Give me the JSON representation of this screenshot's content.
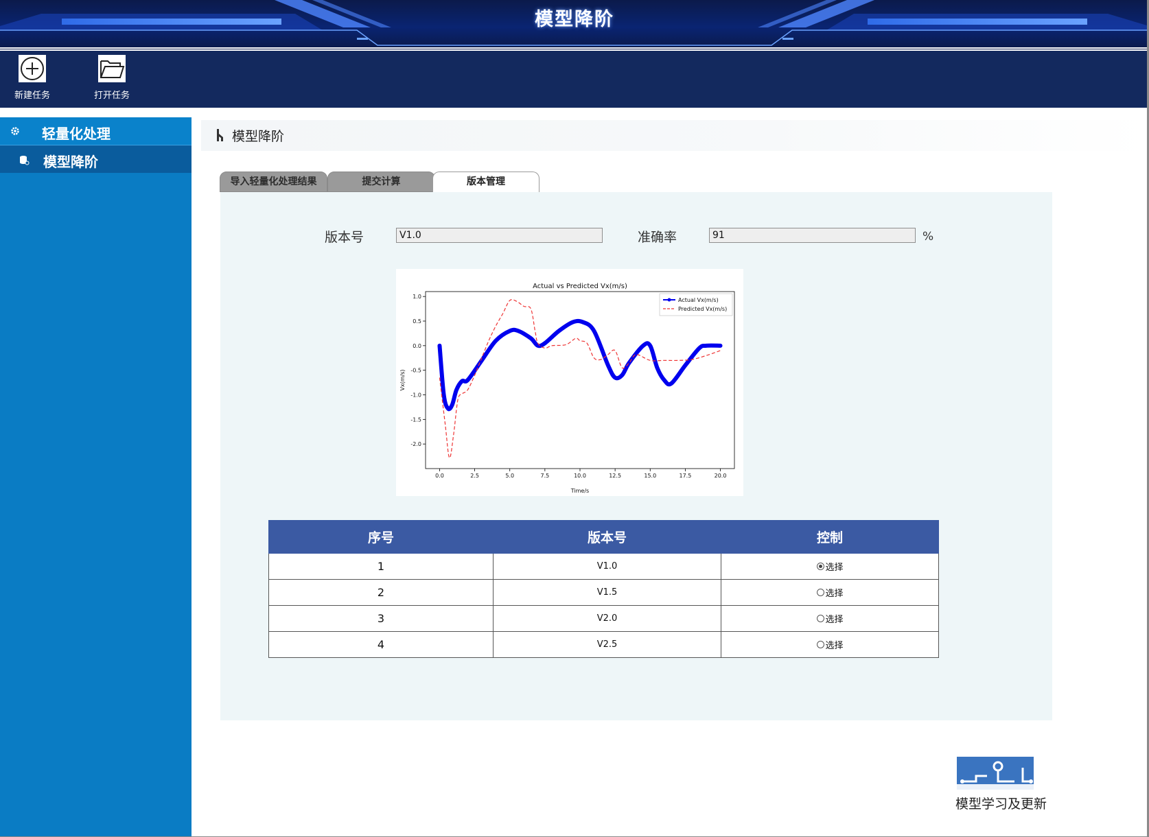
{
  "app": {
    "title": "模型降阶"
  },
  "toolbar": {
    "new_task": {
      "label": "新建任务",
      "icon": "plus-circle-icon"
    },
    "open_task": {
      "label": "打开任务",
      "icon": "folder-open-icon"
    }
  },
  "sidebar": {
    "group": {
      "label": "轻量化处理",
      "icon": "gear-icon"
    },
    "items": [
      {
        "label": "模型降阶",
        "icon": "database-icon",
        "active": true
      }
    ]
  },
  "content": {
    "title": "模型降阶",
    "tabs": [
      {
        "label": "导入轻量化处理结果",
        "active": false
      },
      {
        "label": "提交计算",
        "active": false
      },
      {
        "label": "版本管理",
        "active": true
      }
    ],
    "form": {
      "version_label": "版本号",
      "version_value": "V1.0",
      "accuracy_label": "准确率",
      "accuracy_value": "91",
      "accuracy_unit": "%"
    },
    "table": {
      "headers": [
        "序号",
        "版本号",
        "控制"
      ],
      "rows": [
        {
          "index": "1",
          "version": "V1.0",
          "control": "选择",
          "selected": true
        },
        {
          "index": "2",
          "version": "V1.5",
          "control": "选择",
          "selected": false
        },
        {
          "index": "3",
          "version": "V2.0",
          "control": "选择",
          "selected": false
        },
        {
          "index": "4",
          "version": "V2.5",
          "control": "选择",
          "selected": false
        }
      ]
    }
  },
  "logo": {
    "label": "模型学习及更新"
  },
  "colors": {
    "banner": "#0a2472",
    "toolbar": "#13295e",
    "sidebar": "#0a7cc4",
    "sidebar_active": "#0a5c9d",
    "table_header": "#3b5aa3",
    "panel": "#eef6f8",
    "actual_series": "#0000ee",
    "predicted_series": "#ee3333"
  },
  "chart_data": {
    "type": "line",
    "title": "Actual vs Predicted Vx(m/s)",
    "xlabel": "Time/s",
    "ylabel": "Vx(m/s)",
    "xlim": [
      -1.0,
      21.0
    ],
    "ylim": [
      -2.5,
      1.1
    ],
    "xticks": [
      0.0,
      2.5,
      5.0,
      7.5,
      10.0,
      12.5,
      15.0,
      17.5,
      20.0
    ],
    "yticks": [
      1.0,
      0.5,
      0.0,
      -0.5,
      -1.0,
      -1.5,
      -2.0
    ],
    "legend": "top-right",
    "grid": false,
    "series": [
      {
        "name": "Actual Vx(m/s)",
        "style": "solid-thick-markers",
        "x": [
          0.0,
          0.3,
          0.6,
          0.9,
          1.2,
          1.6,
          2.0,
          3.0,
          4.0,
          5.0,
          5.6,
          6.5,
          7.0,
          7.5,
          8.5,
          9.5,
          10.2,
          11.0,
          12.0,
          12.5,
          13.0,
          13.5,
          14.5,
          15.0,
          15.5,
          16.0,
          16.5,
          17.5,
          18.5,
          19.0,
          20.0
        ],
        "y": [
          0.0,
          -1.0,
          -1.28,
          -1.2,
          -0.9,
          -0.72,
          -0.7,
          -0.3,
          0.1,
          0.3,
          0.3,
          0.15,
          0.0,
          0.05,
          0.3,
          0.48,
          0.48,
          0.3,
          -0.4,
          -0.65,
          -0.6,
          -0.35,
          0.0,
          0.0,
          -0.45,
          -0.7,
          -0.77,
          -0.4,
          -0.05,
          0.0,
          0.0
        ]
      },
      {
        "name": "Predicted Vx(m/s)",
        "style": "dashed",
        "x": [
          0.0,
          0.4,
          0.7,
          1.0,
          1.3,
          1.6,
          2.0,
          2.5,
          3.0,
          3.5,
          4.0,
          4.5,
          5.0,
          5.5,
          6.0,
          6.5,
          6.8,
          7.0,
          7.5,
          8.0,
          9.0,
          9.7,
          10.0,
          10.5,
          11.0,
          11.5,
          12.0,
          12.5,
          13.0,
          13.5,
          14.0,
          15.0,
          16.0,
          17.0,
          18.0,
          19.0,
          20.0
        ],
        "y": [
          -0.65,
          -1.6,
          -2.28,
          -1.8,
          -1.1,
          -0.98,
          -0.9,
          -0.6,
          -0.25,
          0.1,
          0.4,
          0.65,
          0.92,
          0.9,
          0.8,
          0.75,
          0.3,
          0.05,
          -0.05,
          0.0,
          0.02,
          0.15,
          0.1,
          0.05,
          -0.25,
          -0.28,
          -0.18,
          -0.1,
          -0.45,
          -0.35,
          -0.18,
          -0.3,
          -0.3,
          -0.3,
          -0.28,
          -0.2,
          -0.1
        ]
      }
    ]
  }
}
